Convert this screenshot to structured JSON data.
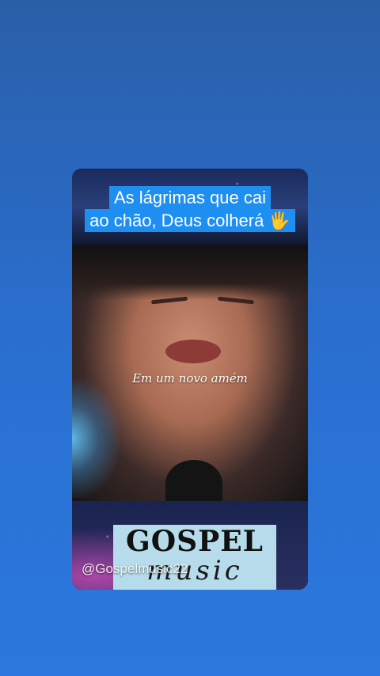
{
  "post": {
    "caption_line1": "As lágrimas que cai",
    "caption_line2": "ao chão, Deus colherá 🖐️",
    "subtitle": "Em um novo amém",
    "logo_main": "GOSPEL",
    "logo_script": "music",
    "watermark": "@Gospelmusic22"
  },
  "colors": {
    "background": "#2a6fd0",
    "caption_bg": "#1e8ff0",
    "logo_bg": "#b6dceb"
  }
}
